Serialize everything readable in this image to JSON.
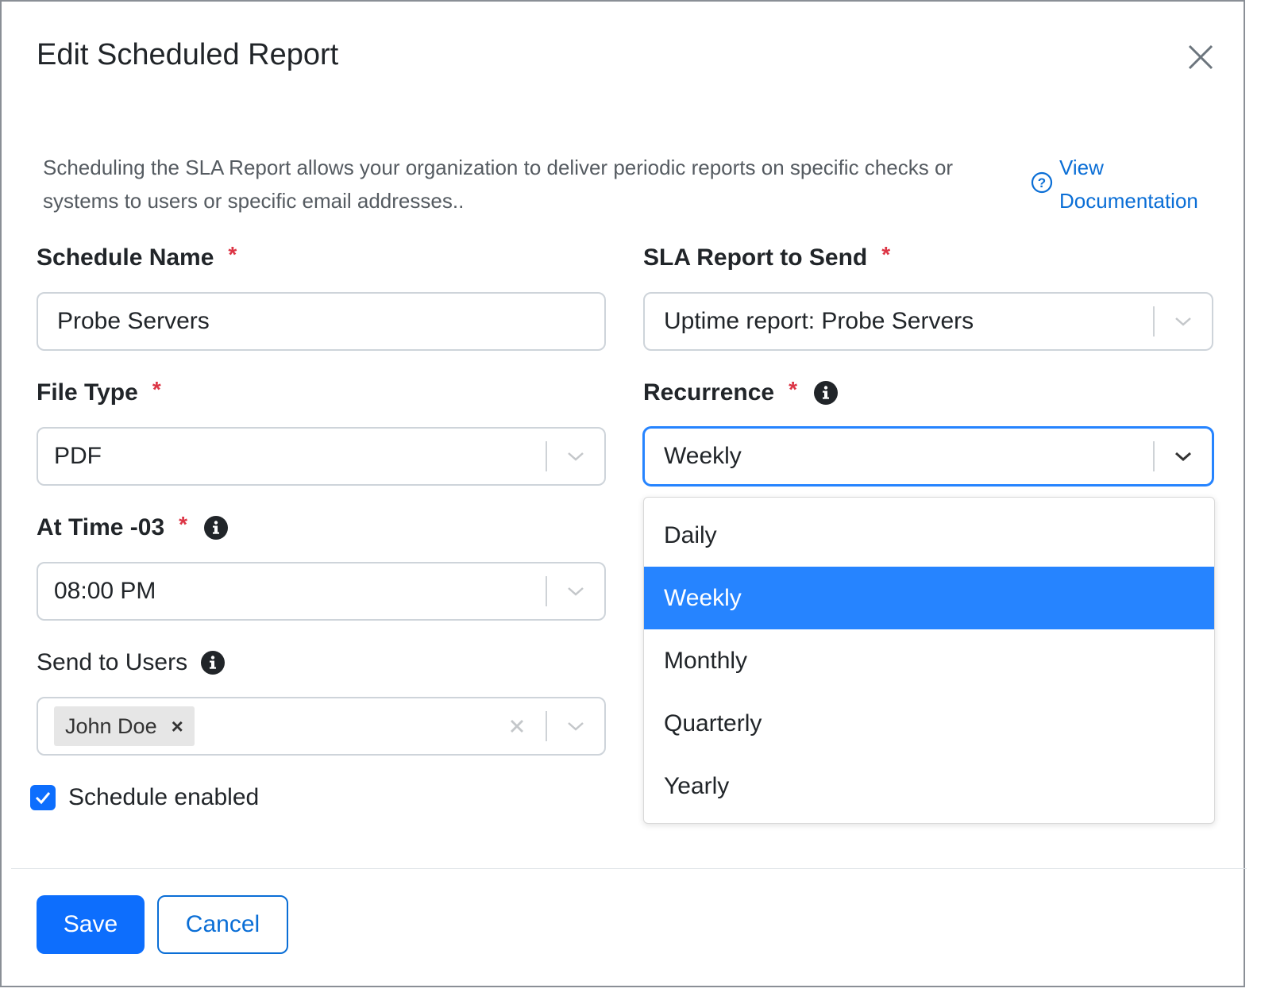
{
  "modal": {
    "title": "Edit Scheduled Report",
    "description": "Scheduling the SLA Report allows your organization to deliver periodic reports on specific checks or systems to users or specific email addresses..",
    "doc_link": "View Documentation",
    "accent_color": "#0d6efd",
    "link_color": "#0a6ed6",
    "required_color": "#dc3545"
  },
  "fields": {
    "schedule_name": {
      "label": "Schedule Name",
      "required": "*",
      "value": "Probe Servers"
    },
    "sla_report": {
      "label": "SLA Report to Send",
      "required": "*",
      "value": "Uptime report: Probe Servers"
    },
    "file_type": {
      "label": "File Type",
      "required": "*",
      "value": "PDF"
    },
    "recurrence": {
      "label": "Recurrence",
      "required": "*",
      "value": "Weekly"
    },
    "at_time": {
      "label": "At Time -03",
      "required": "*",
      "value": "08:00 PM"
    },
    "send_to_users": {
      "label": "Send to Users",
      "tags": [
        "John Doe"
      ],
      "tag_remove": "×"
    }
  },
  "recurrence_options": [
    "Daily",
    "Weekly",
    "Monthly",
    "Quarterly",
    "Yearly"
  ],
  "recurrence_selected": "Weekly",
  "schedule_enabled": {
    "label": "Schedule enabled",
    "checked": true
  },
  "buttons": {
    "save": "Save",
    "cancel": "Cancel"
  }
}
